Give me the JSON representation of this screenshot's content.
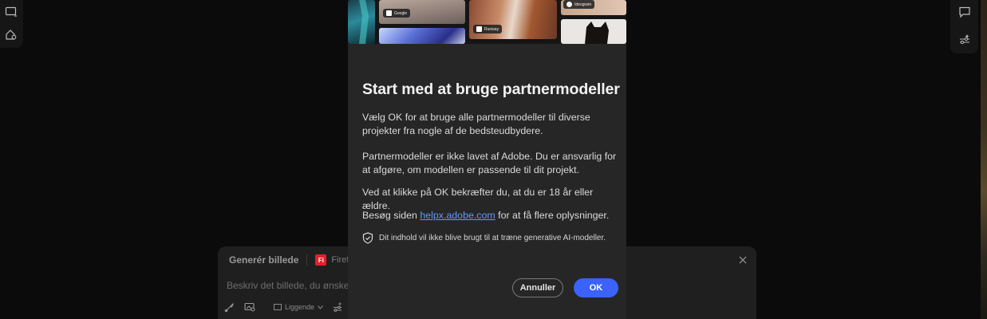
{
  "modal": {
    "hero_labels": {
      "google": "Google",
      "ideogram": "Ideogram",
      "runway": "Runway"
    },
    "title": "Start med at bruge partnermodeller",
    "p1": "Vælg OK for at bruge alle partnermodeller til diverse projekter fra nogle af de bedsteudbydere.",
    "p2": "Partnermodeller er ikke lavet af Adobe. Du er ansvarlig for at afgøre, om modellen er passende til dit projekt.",
    "p3": "Ved at klikke på OK bekræfter du, at du er 18 år eller ældre.",
    "p4_prefix": "Besøg siden ",
    "p4_link": "helpx.adobe.com",
    "p4_suffix": " for at få flere oplysninger.",
    "note": "Dit indhold vil ikke blive brugt til at træne generative AI-modeller.",
    "cancel_label": "Annuller",
    "ok_label": "OK"
  },
  "prompt_panel": {
    "title": "Generér billede",
    "model_badge": "Fi",
    "model_name": "Firefly Im",
    "placeholder": "Beskriv det billede, du ønsker",
    "orientation": "Liggende"
  },
  "colors": {
    "accent": "#3b63fb",
    "link": "#5b9cff",
    "modal_bg": "#262626",
    "page_bg": "#0b0b0b"
  }
}
